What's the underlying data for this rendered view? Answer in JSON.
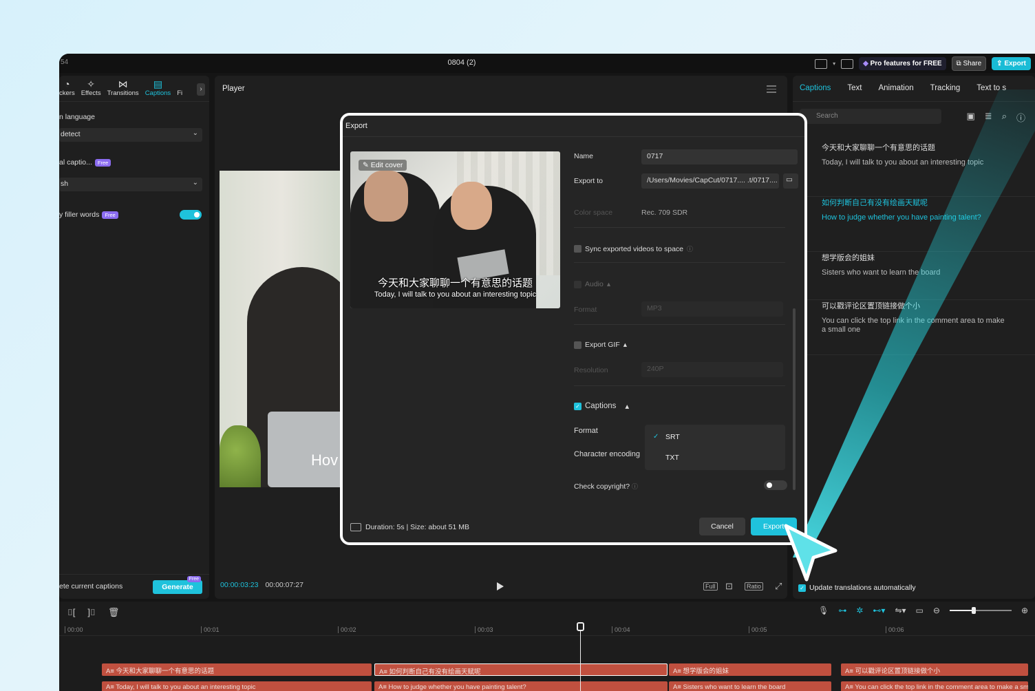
{
  "window": {
    "title": "0804 (2)",
    "project_prefix": "54"
  },
  "titlebar": {
    "pro_label": "Pro features for FREE",
    "share_label": "Share",
    "export_label": "Export"
  },
  "left_panel": {
    "tools": [
      "ckers",
      "Effects",
      "Transitions",
      "Captions",
      "Fi"
    ],
    "language_label": "n language",
    "language_value": "detect",
    "dual_caption_label": "al captio...",
    "free_badge": "Free",
    "target_value": "sh",
    "filler_label": "y filler words",
    "filler_toggle_on": true,
    "delete_label": "ete current captions",
    "generate_label": "Generate",
    "generate_badge": "Free"
  },
  "player": {
    "title": "Player",
    "overlay_text": "Hov",
    "current_time": "00:00:03:23",
    "total_time": "00:00:07:27",
    "controls": [
      "Full",
      "Ratio"
    ]
  },
  "right_panel": {
    "tabs": [
      "Captions",
      "Text",
      "Animation",
      "Tracking",
      "Text to s"
    ],
    "search_placeholder": "Search",
    "captions": [
      {
        "zh": "今天和大家聊聊一个有意思的话题",
        "en": "Today, I will talk to you about an interesting topic"
      },
      {
        "zh": "如何判断自己有没有绘画天赋呢",
        "en": "How to judge whether you have painting talent?"
      },
      {
        "zh": "想学版会的姐妹",
        "en": "Sisters who want to learn the board"
      },
      {
        "zh": "可以戳评论区置顶链接做个小",
        "en": "You can click the top link in the comment area to make a small one"
      }
    ],
    "update_label": "Update translations automatically"
  },
  "export_dialog": {
    "title": "Export",
    "edit_cover": "Edit cover",
    "cover_caption_zh": "今天和大家聊聊一个有意思的话题",
    "cover_caption_en": "Today, I will talk to you about an interesting topic",
    "name_label": "Name",
    "name_value": "0717",
    "export_to_label": "Export to",
    "export_to_value": "/Users/Movies/CapCut/0717.... .t/0717....",
    "color_space_label": "Color space",
    "color_space_value": "Rec. 709 SDR",
    "sync_label": "Sync exported videos to space",
    "audio_label": "Audio",
    "audio_format_label": "Format",
    "audio_format_value": "MP3",
    "gif_label": "Export GIF",
    "gif_resolution_label": "Resolution",
    "gif_resolution_value": "240P",
    "captions_label": "Captions",
    "format_label": "Format",
    "encoding_label": "Character encoding",
    "format_options": [
      "SRT",
      "TXT"
    ],
    "selected_format": "SRT",
    "copyright_label": "Check copyright?",
    "footer": "Duration: 5s | Size: about 51 MB",
    "cancel_label": "Cancel",
    "export_label": "Export"
  },
  "timeline": {
    "ticks": [
      "00:00",
      "00:01",
      "00:02",
      "00:03",
      "00:04",
      "00:05",
      "00:06"
    ],
    "track_zh": [
      "今天和大家聊聊一个有意思的话题",
      "如何判断自己有没有绘画天赋呢",
      "想学版会的姐妹",
      "可以戳评论区置顶链接做个小"
    ],
    "track_en": [
      "Today, I will talk to you about an interesting topic",
      "How to judge whether you have painting talent?",
      "Sisters who want to learn the board",
      "You can click the top link in the comment area to make a small one"
    ]
  },
  "colors": {
    "accent": "#1fc2dc",
    "clip": "#c0503f",
    "badge": "#8b6cf0"
  }
}
